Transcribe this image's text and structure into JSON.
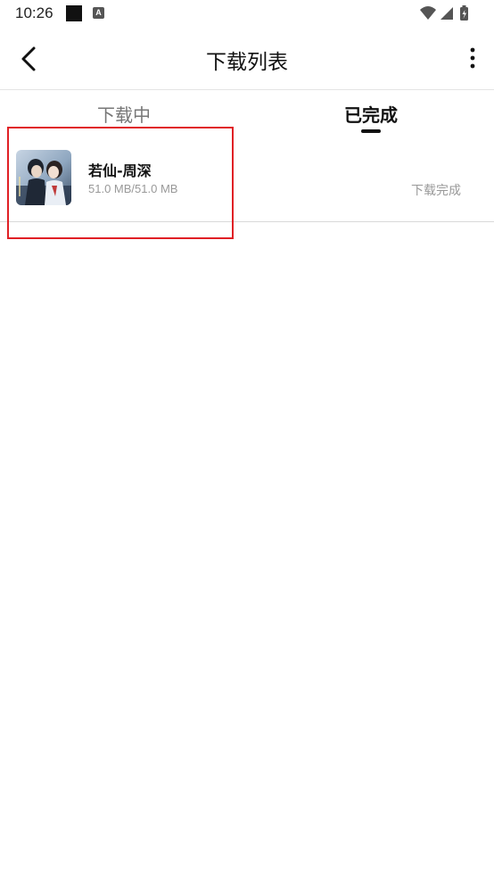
{
  "status_bar": {
    "time": "10:26",
    "icons": [
      "notification-square-icon",
      "notification-a-icon",
      "wifi-icon",
      "signal-icon",
      "battery-icon"
    ],
    "notif_letter": "A"
  },
  "toolbar": {
    "back_icon": "chevron-left-icon",
    "title": "下载列表",
    "more_icon": "more-vertical-icon"
  },
  "tabs": [
    {
      "label": "下载中",
      "active": false
    },
    {
      "label": "已完成",
      "active": true
    }
  ],
  "downloads": [
    {
      "title": "若仙-周深",
      "size": "51.0 MB/51.0 MB",
      "status": "下载完成"
    }
  ],
  "colors": {
    "highlight": "#e02025",
    "active_tab": "#111111",
    "inactive_tab": "#777777",
    "muted_text": "#999999"
  }
}
